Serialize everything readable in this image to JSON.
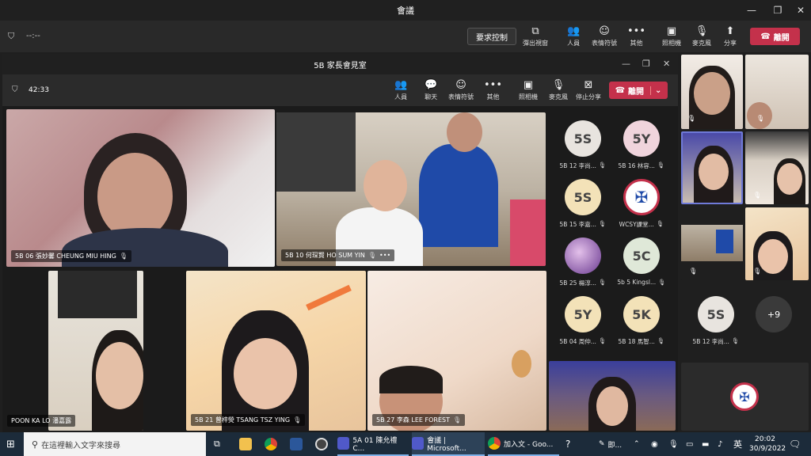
{
  "window": {
    "title": "會議"
  },
  "outer_toolbar": {
    "timer": "--:--",
    "request_control": "要求控制",
    "popout": "彈出視窗",
    "people": "人員",
    "reactions": "表情符號",
    "more": "其他",
    "camera": "照相機",
    "mic": "麥克風",
    "share": "分享",
    "leave": "離開"
  },
  "inner_window": {
    "title": "5B 家長會見室",
    "timer": "42:33",
    "toolbar": {
      "people": "人員",
      "chat": "聊天",
      "reactions": "表情符號",
      "more": "其他",
      "camera": "照相機",
      "mic": "麥克風",
      "stop_share": "停止分享",
      "leave": "離開"
    }
  },
  "video_tiles": [
    {
      "name": "5B 06 張妙馨 CHEUNG MIU HING"
    },
    {
      "name": "5B 10 何琛賢 HO SUM YIN"
    },
    {
      "name": "POON KA LO 潘嘉露"
    },
    {
      "name": "5B 21 曾梓熒 TSANG TSZ YING"
    },
    {
      "name": "5B 27 李森 LEE FOREST"
    }
  ],
  "roster": [
    {
      "initials": "5S",
      "label": "5B 12 李尚...",
      "color": "#e8e4df"
    },
    {
      "initials": "5Y",
      "label": "5B 16 林容...",
      "color": "#f0d4dc"
    },
    {
      "initials": "5S",
      "label": "5B 15 李嘉...",
      "color": "#f3e2b8"
    },
    {
      "initials": "",
      "label": "WCSY課堂...",
      "color": "#ffffff"
    },
    {
      "initials": "",
      "label": "5B 25 楊淳...",
      "color": "#7a4aa0"
    },
    {
      "initials": "5C",
      "label": "5b 5 Kingsl...",
      "color": "#dfe8d8"
    },
    {
      "initials": "5Y",
      "label": "5B 04 周仲...",
      "color": "#f3e2b8"
    },
    {
      "initials": "5K",
      "label": "5B 18 馬智...",
      "color": "#f3e2b8"
    }
  ],
  "right_panel": {
    "avatar_initials": "5S",
    "avatar_label": "5B 12 李尚...",
    "overflow": "+9"
  },
  "taskbar": {
    "search_placeholder": "在這裡輸入文字來搜尋",
    "apps": [
      {
        "label": "5A 01 陳允禮 C..."
      },
      {
        "label": "會議 | Microsoft..."
      },
      {
        "label": "加入文 - Goo..."
      }
    ],
    "misc_label": "即...",
    "ime": "英",
    "time": "20:02",
    "date": "30/9/2022"
  }
}
